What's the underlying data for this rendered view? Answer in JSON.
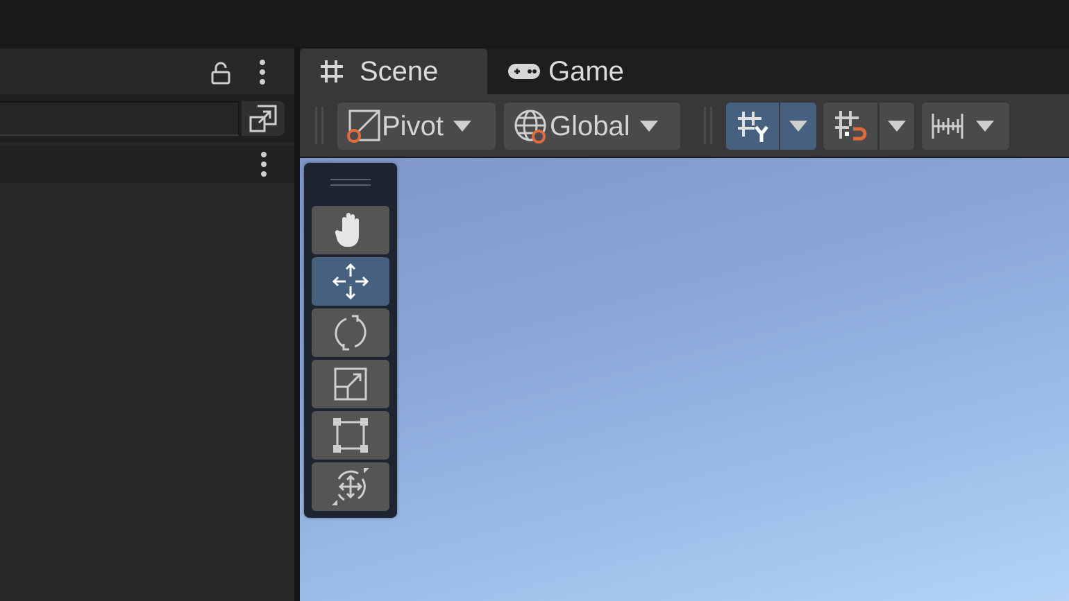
{
  "scene_view": {
    "tabs": [
      {
        "label": "Scene",
        "icon": "grid-hash-icon",
        "active": true
      },
      {
        "label": "Game",
        "icon": "gamepad-icon",
        "active": false
      }
    ],
    "toolbar": {
      "pivot_label": "Pivot",
      "global_label": "Global",
      "grid_snap_active": true
    },
    "viewport_sky_colors": [
      "#7e96c9",
      "#b4d3f7"
    ],
    "tools": [
      {
        "name": "hand-tool",
        "icon": "hand-icon",
        "active": false
      },
      {
        "name": "move-tool",
        "icon": "move-arrows-icon",
        "active": true
      },
      {
        "name": "rotate-tool",
        "icon": "rotate-icon",
        "active": false
      },
      {
        "name": "scale-tool",
        "icon": "scale-icon",
        "active": false
      },
      {
        "name": "rect-tool",
        "icon": "rect-transform-icon",
        "active": false
      },
      {
        "name": "transform-tool",
        "icon": "transform-icon",
        "active": false
      }
    ]
  },
  "hierarchy_panel": {
    "search_value": "",
    "icons": [
      "lock-icon",
      "kebab-menu-icon",
      "expand-search-icon"
    ]
  },
  "colors": {
    "accent_blue": "#46607f",
    "orange_marker": "#e06a3c"
  }
}
